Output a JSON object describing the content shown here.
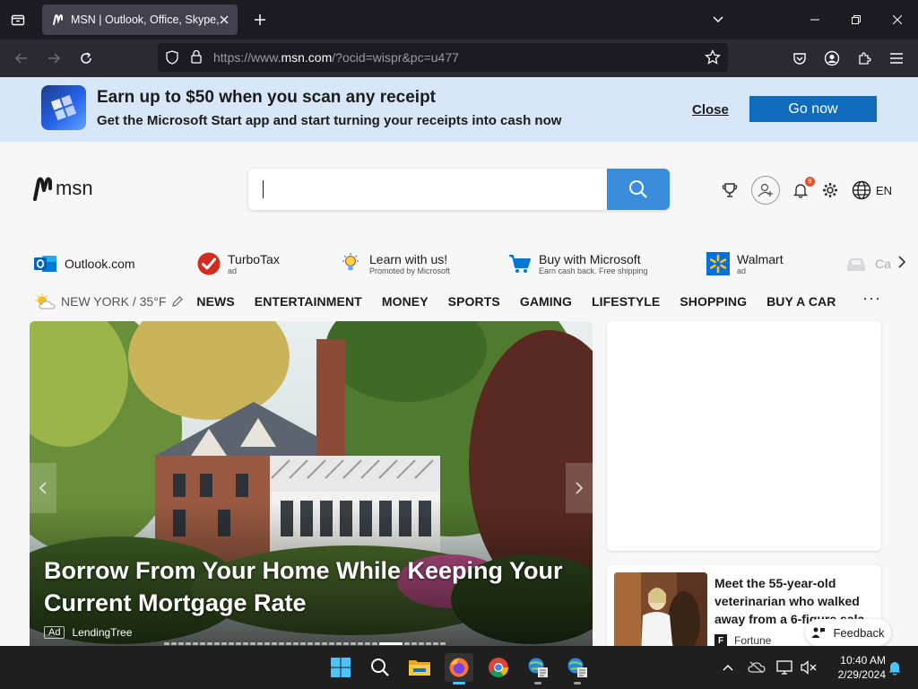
{
  "browser": {
    "tab_title": "MSN | Outlook, Office, Skype, Bing, Breaking News, and Latest Videos",
    "url_prefix": "https://www.",
    "url_domain": "msn.com",
    "url_suffix": "/?ocid=wispr&pc=u477"
  },
  "promo": {
    "title": "Earn up to $50 when you scan any receipt",
    "subtitle": "Get the Microsoft Start app and start turning your receipts into cash now",
    "close_label": "Close",
    "go_label": "Go now"
  },
  "header": {
    "logo_text": "msn",
    "search_value": "",
    "notification_count": "9",
    "language": "EN"
  },
  "quick_links": [
    {
      "label": "Outlook.com",
      "sub": ""
    },
    {
      "label": "TurboTax",
      "sub": "ad"
    },
    {
      "label": "Learn with us!",
      "sub": "Promoted by Microsoft"
    },
    {
      "label": "Buy with Microsoft",
      "sub": "Earn cash back. Free shipping"
    },
    {
      "label": "Walmart",
      "sub": "ad"
    },
    {
      "label": "Ca",
      "sub": ""
    }
  ],
  "nav": {
    "weather": "NEW YORK / 35°F",
    "items": [
      "NEWS",
      "ENTERTAINMENT",
      "MONEY",
      "SPORTS",
      "GAMING",
      "LIFESTYLE",
      "SHOPPING",
      "BUY A CAR"
    ],
    "more": "···"
  },
  "hero": {
    "title": "Borrow From Your Home While Keeping Your Current Mortgage Rate",
    "ad_tag": "Ad",
    "source": "LendingTree"
  },
  "news_card": {
    "title": "Meet the 55-year-old veterinarian who walked away from a 6-figure sala",
    "source_logo": "F",
    "source": "Fortune"
  },
  "feedback_label": "Feedback",
  "taskbar": {
    "time": "10:40 AM",
    "date": "2/29/2024"
  },
  "colors": {
    "accent": "#0f6cbd",
    "search_button": "#3b8ddb",
    "promo_bg": "#d7e6f8",
    "browser_chrome": "#1c1b22"
  }
}
